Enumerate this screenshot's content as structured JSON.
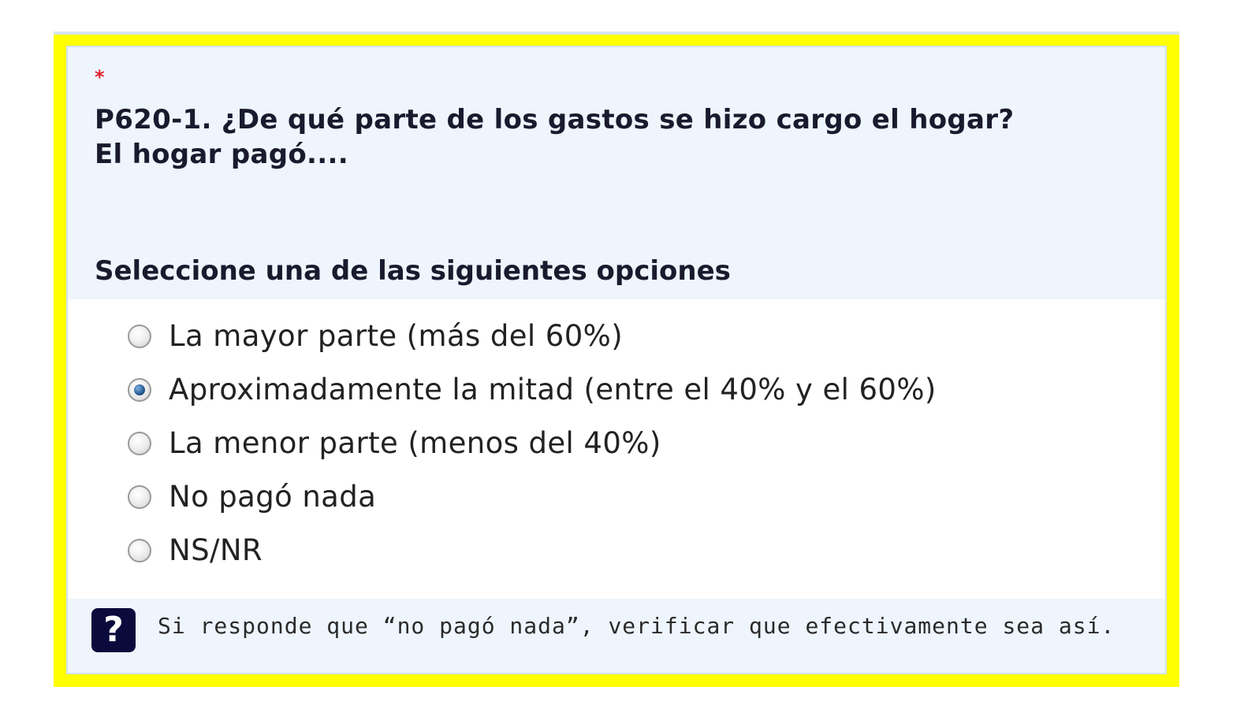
{
  "question": {
    "required_mark": "*",
    "title_line1": "P620-1. ¿De qué parte de los gastos se hizo cargo el hogar?",
    "title_line2": "El hogar pagó....",
    "instruction": "Seleccione una de las siguientes opciones"
  },
  "options": [
    {
      "label": "La mayor parte (más del 60%)",
      "checked": false
    },
    {
      "label": "Aproximadamente la mitad (entre el 40% y el 60%)",
      "checked": true
    },
    {
      "label": "La menor parte (menos del 40%)",
      "checked": false
    },
    {
      "label": "No pagó nada",
      "checked": false
    },
    {
      "label": "NS/NR",
      "checked": false
    }
  ],
  "help": {
    "icon": "question-mark-icon",
    "icon_glyph": "?",
    "text": "Si responde que “no pagó nada”, verificar que efectivamente sea así."
  },
  "colors": {
    "frame": "#ffff00",
    "card_background": "#eef5fc",
    "required": "#e0202a",
    "help_icon": "#0a0a3c"
  }
}
